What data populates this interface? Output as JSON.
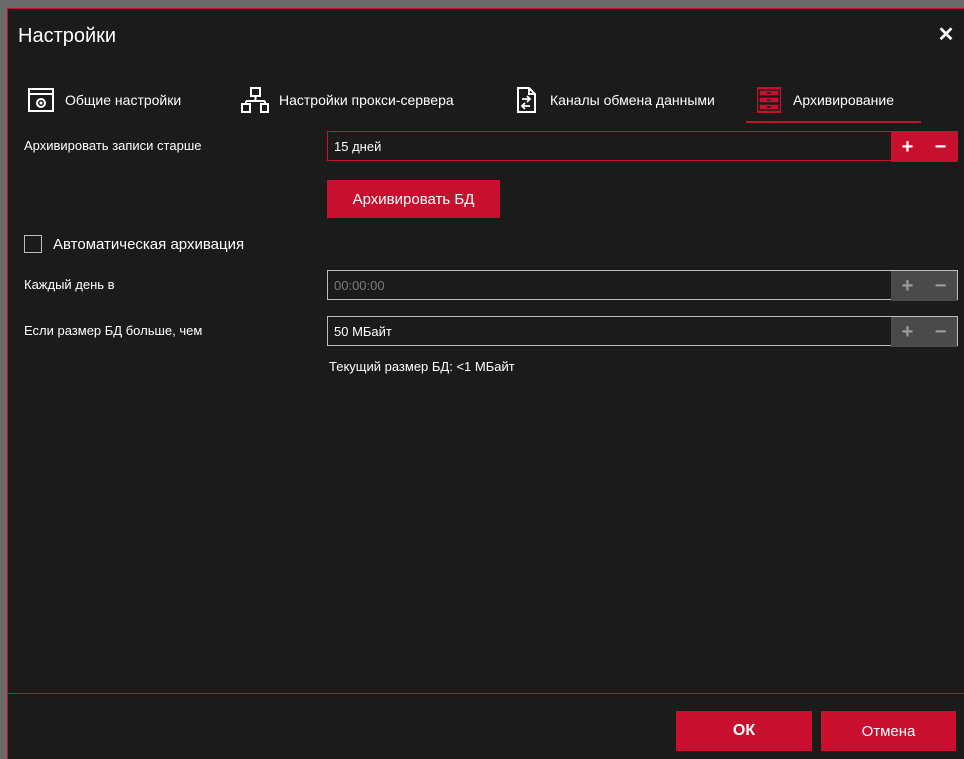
{
  "window": {
    "title": "Настройки",
    "close_glyph": "✕"
  },
  "tabs": [
    {
      "label": "Общие настройки",
      "icon": "settings-window-icon",
      "active": false
    },
    {
      "label": "Настройки прокси-сервера",
      "icon": "network-icon",
      "active": false
    },
    {
      "label": "Каналы обмена данными",
      "icon": "file-exchange-icon",
      "active": false
    },
    {
      "label": "Архивирование",
      "icon": "archive-cabinet-icon",
      "active": true
    }
  ],
  "archive": {
    "older_label": "Архивировать записи старше",
    "older_value": "15 дней",
    "archive_button": "Архивировать БД",
    "auto_label": "Автоматическая архивация",
    "auto_checked": false,
    "daily_label": "Каждый день в",
    "daily_value": "00:00:00",
    "size_label": "Если размер БД больше, чем",
    "size_value": "50 МБайт",
    "current_size": "Текущий размер БД: <1 МБайт"
  },
  "spin": {
    "plus": "+",
    "minus": "−"
  },
  "footer": {
    "ok": "ОК",
    "cancel": "Отмена"
  },
  "colors": {
    "accent": "#c8102e",
    "background": "#1b1b1b",
    "text": "#ffffff"
  }
}
